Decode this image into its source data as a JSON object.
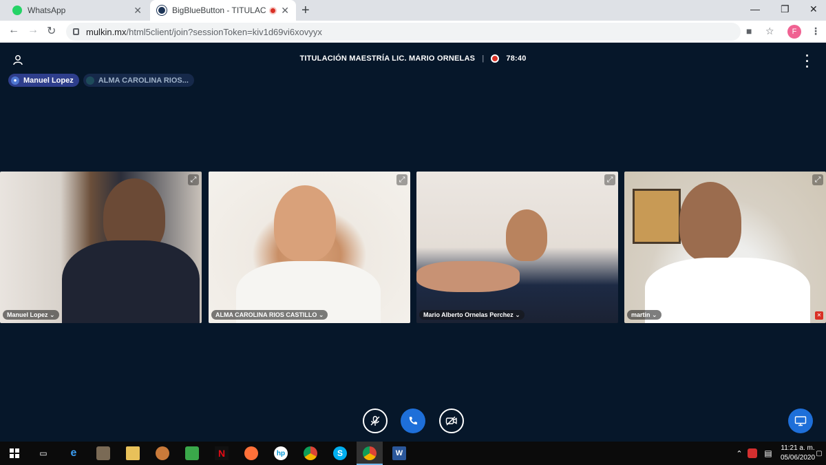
{
  "browser": {
    "tabs": [
      {
        "title": "WhatsApp"
      },
      {
        "title": "BigBlueButton - TITULACIÓN"
      }
    ],
    "new_tab": "+",
    "address": {
      "domain": "mulkin.mx",
      "path": "/html5client/join?sessionToken=kiv1d69vi6xovyyx"
    },
    "profile_initial": "F"
  },
  "meeting": {
    "title": "TITULACIÓN MAESTRÍA LIC. MARIO ORNELAS",
    "separator": "|",
    "recording_time": "78:40",
    "talkers": [
      {
        "name": "Manuel Lopez"
      },
      {
        "name": "ALMA CAROLINA RIOS..."
      }
    ],
    "videos": [
      {
        "label": "Manuel Lopez ⌄"
      },
      {
        "label": "ALMA CAROLINA RIOS CASTILLO ⌄"
      },
      {
        "label": "Mario Alberto Ornelas Perchez ⌄"
      },
      {
        "label": "martin ⌄"
      }
    ]
  },
  "taskbar": {
    "time": "11:21 a. m.",
    "date": "05/06/2020"
  },
  "colors": {
    "meeting_bg": "#06172a",
    "primary_button": "#1e6fd9",
    "recording": "#d93025"
  }
}
